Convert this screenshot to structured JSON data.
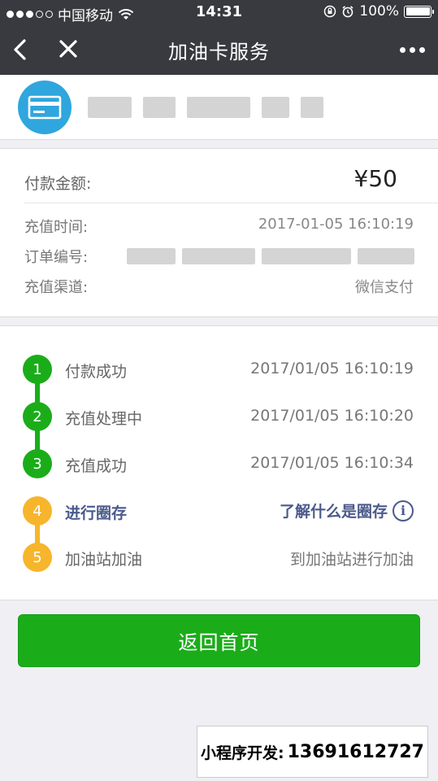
{
  "status_bar": {
    "carrier": "中国移动",
    "time": "14:31",
    "battery": "100%"
  },
  "nav": {
    "title": "加油卡服务"
  },
  "payment": {
    "amount_label": "付款金额:",
    "amount_value": "¥50",
    "recharge_time_label": "充值时间:",
    "recharge_time_value": "2017-01-05 16:10:19",
    "order_no_label": "订单编号:",
    "channel_label": "充值渠道:",
    "channel_value": "微信支付"
  },
  "steps": [
    {
      "num": "1",
      "label": "付款成功",
      "time": "2017/01/05 16:10:19",
      "color": "#1aad19"
    },
    {
      "num": "2",
      "label": "充值处理中",
      "time": "2017/01/05 16:10:20",
      "color": "#1aad19"
    },
    {
      "num": "3",
      "label": "充值成功",
      "time": "2017/01/05 16:10:34",
      "color": "#1aad19"
    },
    {
      "num": "4",
      "label": "进行圈存",
      "link": "了解什么是圈存",
      "color": "#f7b52b"
    },
    {
      "num": "5",
      "label": "加油站加油",
      "time": "到加油站进行加油",
      "color": "#f7b52b"
    }
  ],
  "home_button": "返回首页",
  "watermark": {
    "label": "小程序开发:",
    "phone": "13691612727"
  },
  "colors": {
    "nav_bg": "#393a3f",
    "success_green": "#1aad19",
    "pending_orange": "#f7b52b",
    "link_blue": "#4b5a8b"
  }
}
